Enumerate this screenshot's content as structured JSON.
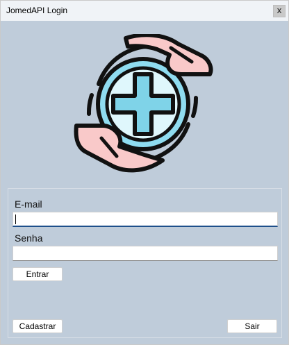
{
  "window": {
    "title": "JomedAPI Login",
    "close_glyph": "x"
  },
  "logo": {
    "icon": "healthcare-hands-cross-icon"
  },
  "form": {
    "email_label": "E-mail",
    "email_value": "",
    "password_label": "Senha",
    "password_value": "",
    "login_button": "Entrar",
    "register_button": "Cadastrar",
    "exit_button": "Sair"
  },
  "colors": {
    "background": "#bfccda",
    "titlebar": "#f0f3f7",
    "accent": "#1e4f8a",
    "cross": "#7fd3e8",
    "hand": "#f9c9c9"
  }
}
